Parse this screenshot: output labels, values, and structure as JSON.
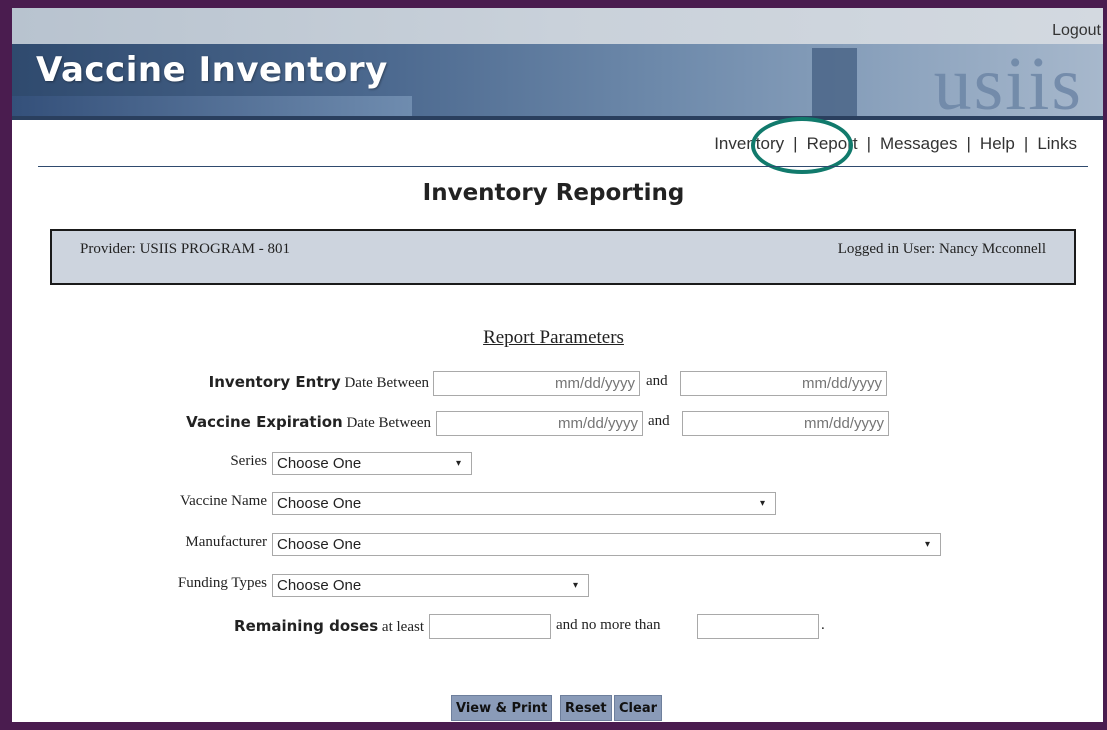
{
  "header": {
    "app_title": "Vaccine Inventory",
    "logo_text": "usiis",
    "logout_label": "Logout"
  },
  "nav": {
    "items": [
      "Inventory",
      "Report",
      "Messages",
      "Help",
      "Links"
    ],
    "separator": "|",
    "highlighted": "Report",
    "highlight_color": "#117a6c"
  },
  "page_title": "Inventory Reporting",
  "info": {
    "provider": "Provider: USIIS PROGRAM - 801",
    "user": "Logged in User: Nancy Mcconnell"
  },
  "form": {
    "section_title": "Report Parameters",
    "entry_date": {
      "label_bold": "Inventory Entry",
      "label_rest": " Date Between",
      "from_placeholder": "mm/dd/yyyy",
      "and_label": "and",
      "to_placeholder": "mm/dd/yyyy"
    },
    "expiration_date": {
      "label_bold": "Vaccine Expiration",
      "label_rest": " Date Between",
      "from_placeholder": "mm/dd/yyyy",
      "and_label": "and",
      "to_placeholder": "mm/dd/yyyy"
    },
    "series": {
      "label": "Series",
      "value": "Choose One"
    },
    "vaccine_name": {
      "label": "Vaccine Name",
      "value": "Choose One"
    },
    "manufacturer": {
      "label": "Manufacturer",
      "value": "Choose One"
    },
    "funding_types": {
      "label": "Funding Types",
      "value": "Choose One"
    },
    "remaining_doses": {
      "label_bold": "Remaining doses",
      "label_rest": " at least",
      "and_label": "and no more than",
      "period": "."
    }
  },
  "buttons": {
    "view_print": "View & Print",
    "reset": "Reset",
    "clear": "Clear"
  },
  "icons": {
    "dropdown": "▾"
  },
  "colors": {
    "frame": "#4a1c4f",
    "banner": "#4d6a90",
    "info_box": "#cdd4de",
    "button": "#8a9bb8"
  }
}
